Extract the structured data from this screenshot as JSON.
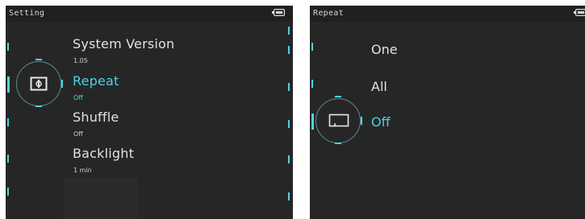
{
  "left_panel": {
    "title": "Setting",
    "items": [
      {
        "label": "System Version",
        "value": "1.05"
      },
      {
        "label": "Repeat",
        "value": "Off"
      },
      {
        "label": "Shuffle",
        "value": "Off"
      },
      {
        "label": "Backlight",
        "value": "1 min"
      }
    ],
    "selected_index": 1,
    "selected_icon": "repeat-settings-icon"
  },
  "right_panel": {
    "title": "Repeat",
    "options": [
      "One",
      "All",
      "Off"
    ],
    "selected_index": 2,
    "selected_icon": "repeat-off-icon"
  },
  "colors": {
    "accent": "#4bd4e0",
    "background": "#262626",
    "text": "#e2e2e2"
  },
  "icons": {
    "battery": "battery-icon"
  }
}
